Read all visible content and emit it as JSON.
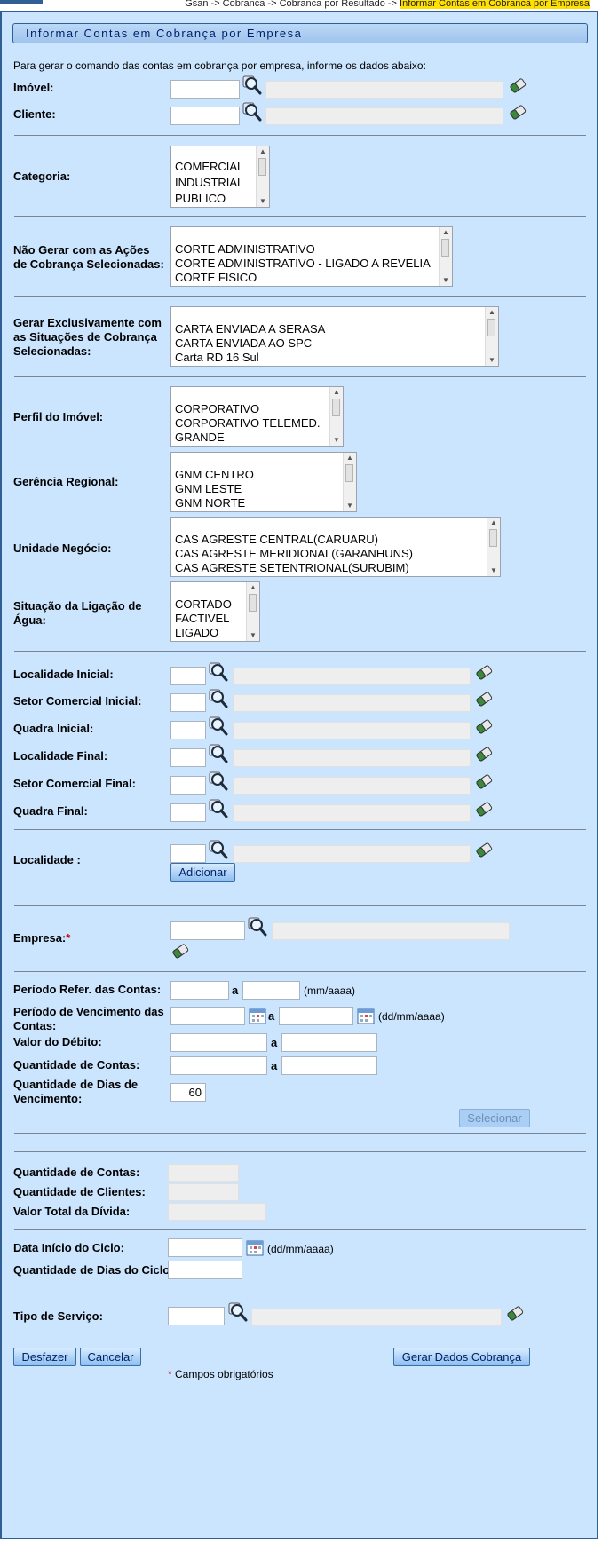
{
  "breadcrumb": {
    "path": "Gsan -> Cobranca -> Cobranca por Resultado -> ",
    "current": "Informar Contas em Cobranca por Empresa"
  },
  "title": "Informar Contas em Cobrança por Empresa",
  "intro": "Para gerar o comando das contas em cobrança por empresa, informe os dados abaixo:",
  "labels": {
    "imovel": "Imóvel:",
    "cliente": "Cliente:",
    "categoria": "Categoria:",
    "nao_gerar": "Não Gerar com as Ações de Cobrança Selecionadas:",
    "gerar_excl": "Gerar Exclusivamente com as Situações de Cobrança Selecionadas:",
    "perfil": "Perfil do Imóvel:",
    "gerencia": "Gerência Regional:",
    "unidade": "Unidade Negócio:",
    "situacao_agua": "Situação da Ligação de Água:",
    "loc_ini": "Localidade Inicial:",
    "setor_ini": "Setor Comercial Inicial:",
    "quadra_ini": "Quadra Inicial:",
    "loc_fin": "Localidade Final:",
    "setor_fin": "Setor Comercial Final:",
    "quadra_fin": "Quadra Final:",
    "localidade": "Localidade :",
    "empresa": "Empresa:",
    "periodo_ref": "Período Refer. das Contas:",
    "periodo_venc": "Período de Vencimento das Contas:",
    "valor_debito": "Valor do Débito:",
    "qtd_contas": "Quantidade de Contas:",
    "qtd_dias_venc": "Quantidade de Dias de Vencimento:",
    "res_qtd_contas": "Quantidade de Contas:",
    "res_qtd_clientes": "Quantidade de Clientes:",
    "res_valor_total": "Valor Total da Dívida:",
    "data_inicio": "Data Início do Ciclo:",
    "qtd_dias_ciclo": "Quantidade de Dias do Ciclo:",
    "tipo_servico": "Tipo de Serviço:"
  },
  "separator_a": "a",
  "formats": {
    "mes_ano": "(mm/aaaa)",
    "dia_mes_ano": "(dd/mm/aaaa)"
  },
  "required_mark": "*",
  "lists": {
    "categoria": [
      "COMERCIAL",
      "INDUSTRIAL",
      "PUBLICO"
    ],
    "nao_gerar": [
      "CORTE ADMINISTRATIVO",
      "CORTE ADMINISTRATIVO - LIGADO A REVELIA",
      "CORTE FISICO"
    ],
    "gerar_excl": [
      "CARTA ENVIADA A SERASA",
      "CARTA ENVIADA AO SPC",
      "Carta RD 16 Sul"
    ],
    "perfil": [
      "CORPORATIVO",
      "CORPORATIVO TELEMED.",
      "GRANDE"
    ],
    "gerencia": [
      "GNM CENTRO",
      "GNM LESTE",
      "GNM NORTE"
    ],
    "unidade": [
      "CAS AGRESTE CENTRAL(CARUARU)",
      "CAS AGRESTE MERIDIONAL(GARANHUNS)",
      "CAS AGRESTE SETENTRIONAL(SURUBIM)"
    ],
    "situacao_agua": [
      "CORTADO",
      "FACTIVEL",
      "LIGADO"
    ]
  },
  "values": {
    "qtd_dias_venc": "60"
  },
  "buttons": {
    "adicionar": "Adicionar",
    "selecionar": "Selecionar",
    "desfazer": "Desfazer",
    "cancelar": "Cancelar",
    "gerar": "Gerar Dados Cobrança"
  },
  "footer_note": "Campos obrigatórios",
  "icons": {
    "search": "search-lens-icon",
    "clear": "eraser-icon",
    "calendar": "calendar-icon"
  },
  "colors": {
    "panel_bg": "#cbe5fe",
    "border": "#2f5f95",
    "required": "#cc0000",
    "highlight": "#ffe000"
  }
}
